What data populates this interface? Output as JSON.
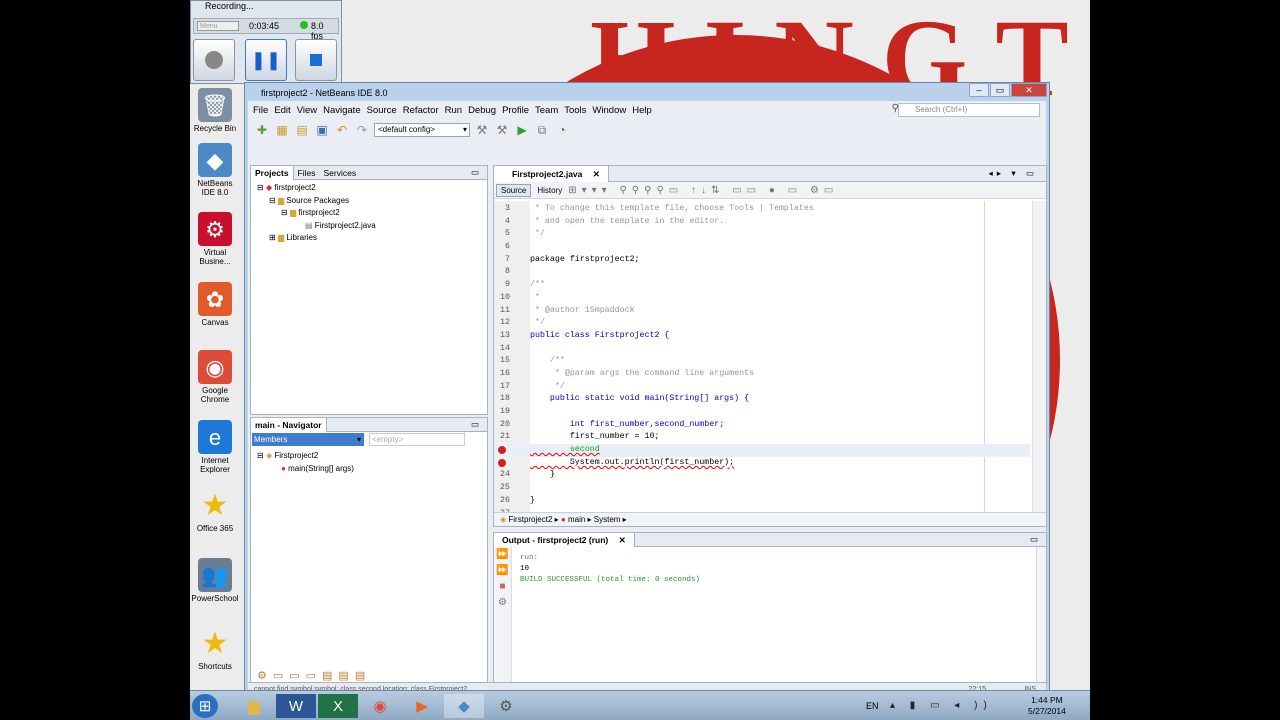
{
  "desktop": {
    "icons": [
      {
        "label": "Recycle Bin",
        "glyph": "🗑",
        "color": "#7f8fa3"
      },
      {
        "label": "NetBeans IDE 8.0",
        "glyph": "◆",
        "color": "#4b8ac6"
      },
      {
        "label": "Virtual Busine...",
        "glyph": "⚙",
        "color": "#c8102e"
      },
      {
        "label": "Canvas",
        "glyph": "✿",
        "color": "#e05a2b"
      },
      {
        "label": "Google Chrome",
        "glyph": "◉",
        "color": "#dd4b39"
      },
      {
        "label": "Internet Explorer",
        "glyph": "e",
        "color": "#1e78d7"
      },
      {
        "label": "Office 365",
        "glyph": "★",
        "color": "#f2b90d"
      },
      {
        "label": "PowerSchool",
        "glyph": "👥",
        "color": "#6b7d95"
      },
      {
        "label": "Shortcuts",
        "glyph": "★",
        "color": "#f2b90d"
      }
    ]
  },
  "recorder": {
    "title": "Recording...",
    "menu": "Menu",
    "time": "0:03:45",
    "fps": "8.0 fps"
  },
  "ide": {
    "title": "firstproject2 - NetBeans IDE 8.0",
    "menus": [
      "File",
      "Edit",
      "View",
      "Navigate",
      "Source",
      "Refactor",
      "Run",
      "Debug",
      "Profile",
      "Team",
      "Tools",
      "Window",
      "Help"
    ],
    "search_placeholder": "Search (Ctrl+I)",
    "config": "<default config>",
    "projects_tabs": [
      "Projects",
      "Files",
      "Services"
    ],
    "tree": [
      "firstproject2",
      "Source Packages",
      "firstproject2",
      "Firstproject2.java",
      "Libraries"
    ],
    "navigator_title": "main - Navigator",
    "navigator_filter": "Members",
    "navigator_empty": "<empty>",
    "navigator_tree": [
      "Firstproject2",
      "main(String[] args)"
    ],
    "editor_tab": "Firstproject2.java",
    "editor_views": [
      "Source",
      "History"
    ],
    "breadcrumbs": [
      "Firstproject2",
      "main",
      "System"
    ],
    "output_title": "Output - firstproject2 (run)",
    "output_lines": [
      "run:",
      "10",
      "BUILD SUCCESSFUL (total time: 0 seconds)"
    ],
    "status_text": "cannot find symbol   symbol:  class second   location: class Firstproject2",
    "status_pos": "22:15",
    "status_mode": "INS"
  },
  "code": [
    {
      "n": "3",
      "t": " * To change this template file, choose Tools | Templates",
      "c": "cm"
    },
    {
      "n": "4",
      "t": " * and open the template in the editor.",
      "c": "cm"
    },
    {
      "n": "5",
      "t": " */",
      "c": "cm"
    },
    {
      "n": "6",
      "t": "",
      "c": ""
    },
    {
      "n": "7",
      "t": "package firstproject2;",
      "c": ""
    },
    {
      "n": "8",
      "t": "",
      "c": ""
    },
    {
      "n": "9",
      "t": "/**",
      "c": "cm"
    },
    {
      "n": "10",
      "t": " *",
      "c": "cm"
    },
    {
      "n": "11",
      "t": " * @author 15mpaddock",
      "c": "cm"
    },
    {
      "n": "12",
      "t": " */",
      "c": "cm"
    },
    {
      "n": "13",
      "t": "public class Firstproject2 {",
      "c": "cls"
    },
    {
      "n": "14",
      "t": "",
      "c": ""
    },
    {
      "n": "15",
      "t": "    /**",
      "c": "cm"
    },
    {
      "n": "16",
      "t": "     * @param args the command line arguments",
      "c": "cm"
    },
    {
      "n": "17",
      "t": "     */",
      "c": "cm"
    },
    {
      "n": "18",
      "t": "    public static void main(String[] args) {",
      "c": "main"
    },
    {
      "n": "19",
      "t": "",
      "c": ""
    },
    {
      "n": "20",
      "t": "        int first_number,second_number;",
      "c": "decl"
    },
    {
      "n": "21",
      "t": "        first_number = 10;",
      "c": "asg"
    },
    {
      "n": "",
      "t": "        second",
      "c": "errline"
    },
    {
      "n": "",
      "t": "        System.out.println(first_number);",
      "c": "print"
    },
    {
      "n": "24",
      "t": "    }",
      "c": ""
    },
    {
      "n": "25",
      "t": "",
      "c": ""
    },
    {
      "n": "26",
      "t": "}",
      "c": ""
    },
    {
      "n": "27",
      "t": "",
      "c": ""
    }
  ],
  "taskbar": {
    "lang": "EN",
    "time": "1:44 PM",
    "date": "5/27/2014"
  }
}
